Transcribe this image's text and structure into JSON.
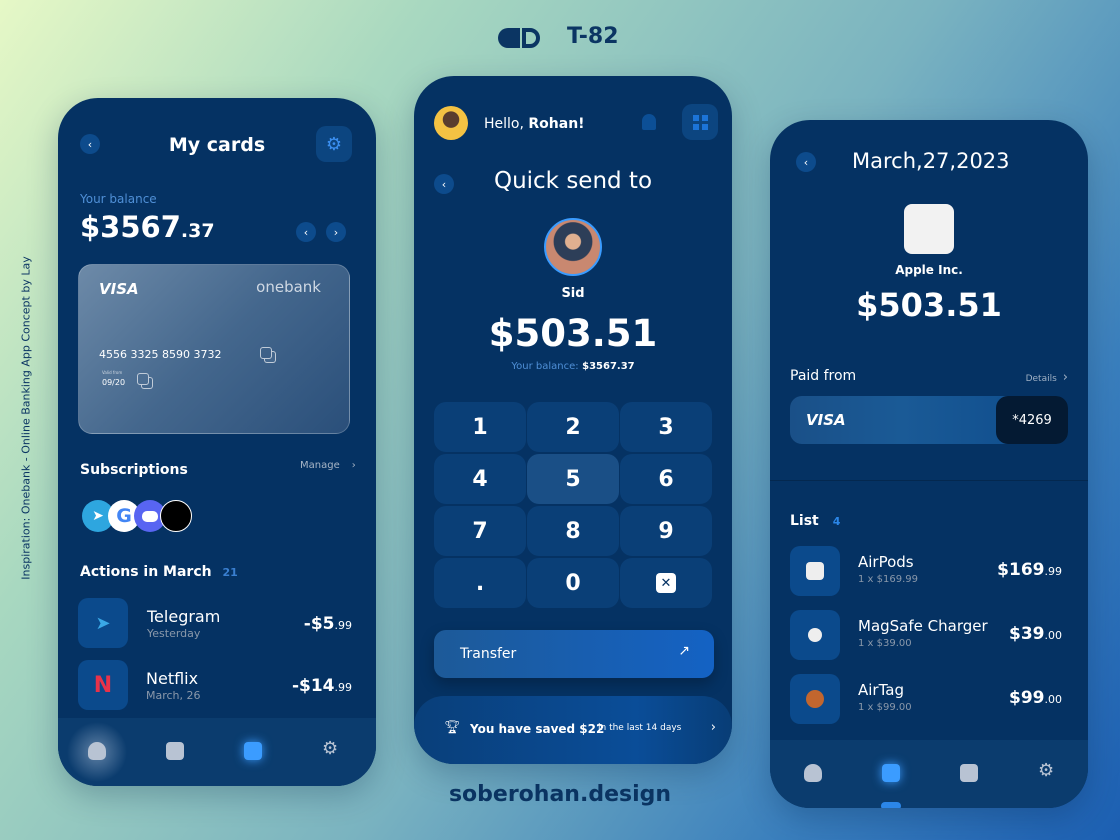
{
  "header": {
    "logo": "D",
    "code": "T-82"
  },
  "side_caption": "Inspiration: Onebank - Online Banking App Concept by Lay",
  "footer": "soberohan.design",
  "colors": {
    "phone_bg": "#053263",
    "accent": "#3b9cff",
    "visa_dark": "#041a33"
  },
  "cards_screen": {
    "title": "My cards",
    "balance_label": "Your balance",
    "balance_main": "$3567",
    "balance_cents": ".37",
    "card": {
      "brand": "VISA",
      "bank": "onebank",
      "number": "4556 3325 8590 3732",
      "valid_label": "Valid from",
      "valid": "09/20"
    },
    "subscriptions_title": "Subscriptions",
    "manage": "Manage",
    "subscriptions": [
      "telegram",
      "google",
      "discord",
      "apple"
    ],
    "actions_title": "Actions in March",
    "actions_count": "21",
    "actions": [
      {
        "name": "Telegram",
        "date": "Yesterday",
        "amount": "-$5",
        "cents": ".99",
        "icon": "telegram-icon"
      },
      {
        "name": "Netflix",
        "date": "March, 26",
        "amount": "-$14",
        "cents": ".99",
        "icon": "netflix-icon"
      }
    ],
    "nav": [
      "home",
      "stats",
      "cards",
      "settings"
    ],
    "nav_active": "cards"
  },
  "send_screen": {
    "greeting": "Hello, ",
    "user": "Rohan!",
    "title": "Quick send to",
    "recipient": "Sid",
    "amount": "$503.51",
    "balance_label": "Your balance:",
    "balance": "$3567.37",
    "keys": [
      "1",
      "2",
      "3",
      "4",
      "5",
      "6",
      "7",
      "8",
      "9",
      ".",
      "0",
      "⌫"
    ],
    "transfer": "Transfer",
    "saved_text": "You have saved $22",
    "saved_period": "in the last 14 days"
  },
  "receipt_screen": {
    "date": "March,27,2023",
    "merchant": "Apple Inc.",
    "amount": "$503.51",
    "paid_from": "Paid from",
    "details": "Details",
    "card_brand": "VISA",
    "card_last": "*4269",
    "list_title": "List",
    "list_count": "4",
    "items": [
      {
        "name": "AirPods",
        "qty": "1 x $169.99",
        "price": "$169",
        "cents": ".99"
      },
      {
        "name": "MagSafe Charger",
        "qty": "1 x $39.00",
        "price": "$39",
        "cents": ".00"
      },
      {
        "name": "AirTag",
        "qty": "1 x $99.00",
        "price": "$99",
        "cents": ".00"
      }
    ],
    "nav_active": "stats"
  }
}
